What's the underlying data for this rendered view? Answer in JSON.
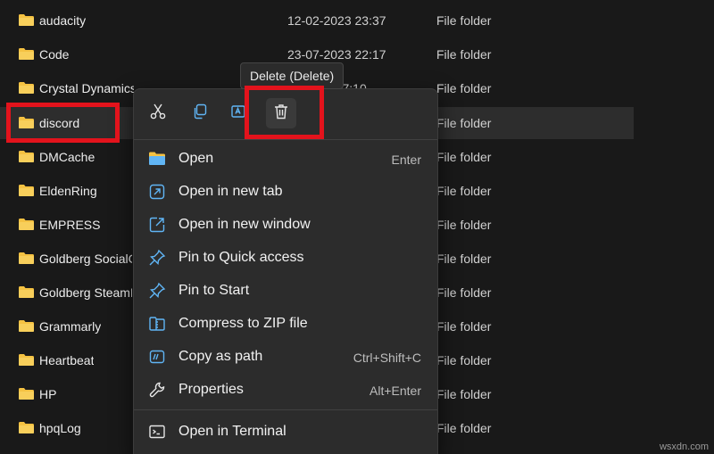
{
  "files": [
    {
      "name": "audacity",
      "date": "12-02-2023 23:37",
      "type": "File folder"
    },
    {
      "name": "Code",
      "date": "23-07-2023 22:17",
      "type": "File folder"
    },
    {
      "name": "Crystal Dynamics",
      "date": "…-2023 07:10",
      "type": "File folder"
    },
    {
      "name": "discord",
      "date": "",
      "type": "File folder",
      "selected": true
    },
    {
      "name": "DMCache",
      "date": "",
      "type": "File folder"
    },
    {
      "name": "EldenRing",
      "date": "",
      "type": "File folder"
    },
    {
      "name": "EMPRESS",
      "date": "",
      "type": "File folder"
    },
    {
      "name": "Goldberg SocialC",
      "date": "",
      "type": "File folder"
    },
    {
      "name": "Goldberg SteamE",
      "date": "",
      "type": "File folder"
    },
    {
      "name": "Grammarly",
      "date": "",
      "type": "File folder"
    },
    {
      "name": "Heartbeat",
      "date": "",
      "type": "File folder"
    },
    {
      "name": "HP",
      "date": "",
      "type": "File folder"
    },
    {
      "name": "hpqLog",
      "date": "",
      "type": "File folder"
    }
  ],
  "tooltip": "Delete (Delete)",
  "quick_actions": [
    {
      "name": "cut",
      "icon": "scissors-icon"
    },
    {
      "name": "copy",
      "icon": "copy-icon"
    },
    {
      "name": "rename",
      "icon": "rename-icon"
    },
    {
      "name": "delete",
      "icon": "trash-icon"
    }
  ],
  "menu": {
    "items": [
      {
        "label": "Open",
        "shortcut": "Enter",
        "icon": "folder-icon"
      },
      {
        "label": "Open in new tab",
        "shortcut": "",
        "icon": "new-tab-icon"
      },
      {
        "label": "Open in new window",
        "shortcut": "",
        "icon": "new-window-icon"
      },
      {
        "label": "Pin to Quick access",
        "shortcut": "",
        "icon": "pin-icon"
      },
      {
        "label": "Pin to Start",
        "shortcut": "",
        "icon": "pin-icon"
      },
      {
        "label": "Compress to ZIP file",
        "shortcut": "",
        "icon": "zip-icon"
      },
      {
        "label": "Copy as path",
        "shortcut": "Ctrl+Shift+C",
        "icon": "copy-path-icon"
      },
      {
        "label": "Properties",
        "shortcut": "Alt+Enter",
        "icon": "wrench-icon"
      }
    ],
    "terminal": {
      "label": "Open in Terminal",
      "icon": "terminal-icon"
    }
  },
  "watermark": "wsxdn.com",
  "colors": {
    "accent": "#e3131c",
    "folder": "#f5c242",
    "icon_blue": "#60b5f5"
  }
}
